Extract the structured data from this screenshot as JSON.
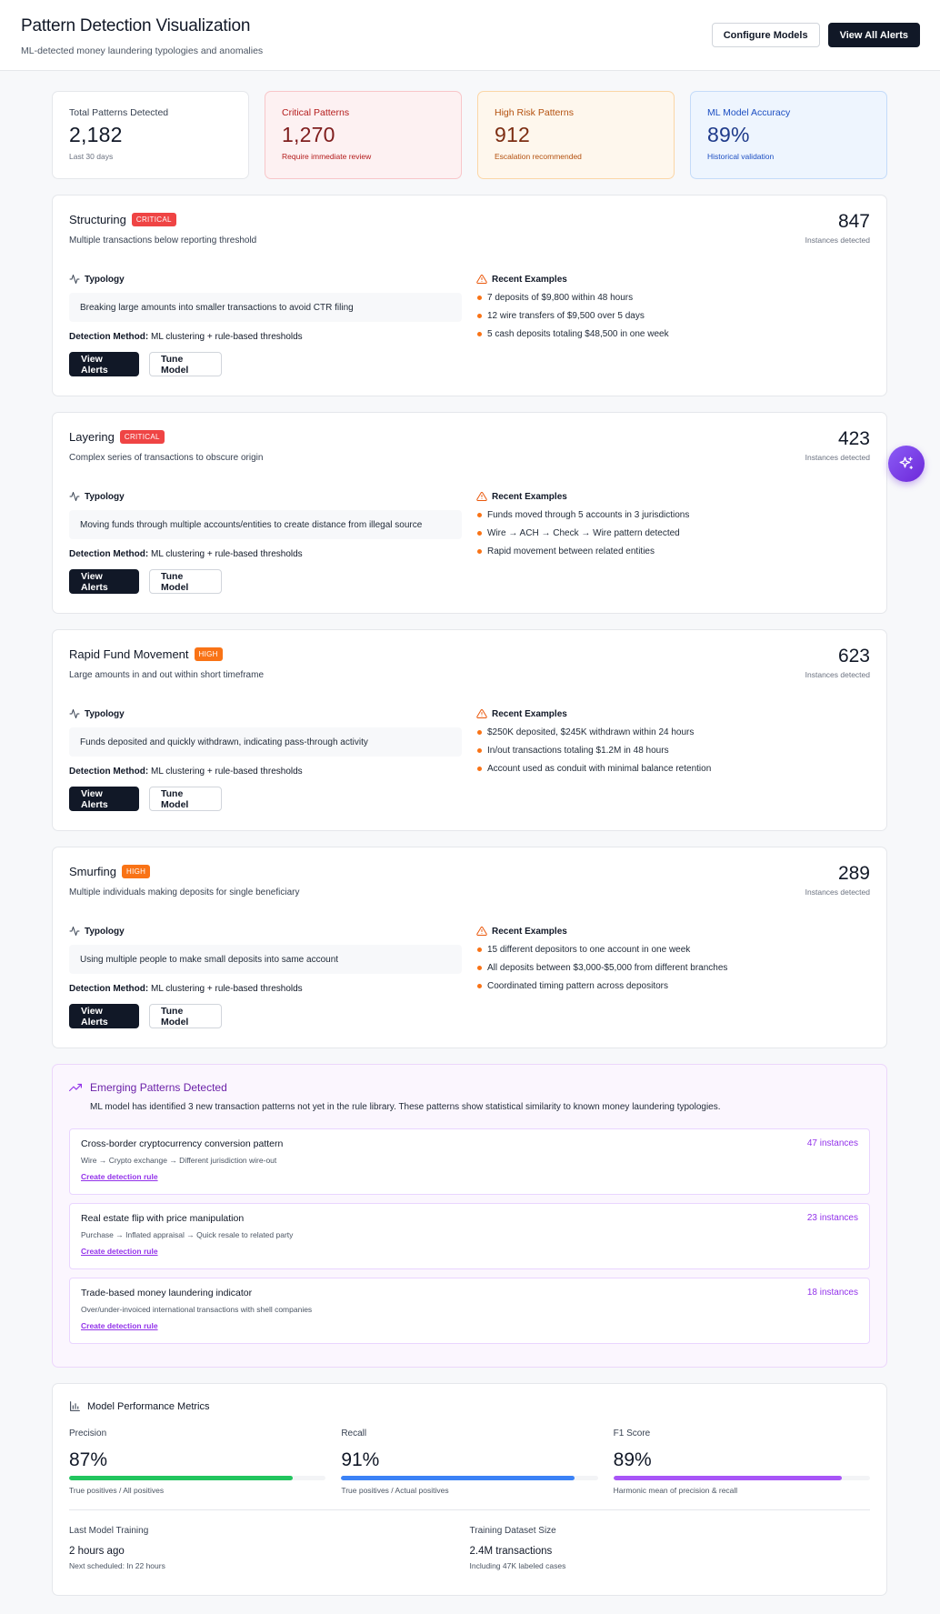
{
  "header": {
    "title": "Pattern Detection Visualization",
    "subtitle": "ML-detected money laundering typologies and anomalies",
    "configure_label": "Configure Models",
    "view_all_label": "View All Alerts"
  },
  "stats": [
    {
      "label": "Total Patterns Detected",
      "value": "2,182",
      "note": "Last 30 days",
      "tone": "neutral"
    },
    {
      "label": "Critical Patterns",
      "value": "1,270",
      "note": "Require immediate review",
      "tone": "critical"
    },
    {
      "label": "High Risk Patterns",
      "value": "912",
      "note": "Escalation recommended",
      "tone": "high"
    },
    {
      "label": "ML Model Accuracy",
      "value": "89%",
      "note": "Historical validation",
      "tone": "accuracy"
    }
  ],
  "pattern_common": {
    "typology_heading": "Typology",
    "examples_heading": "Recent Examples",
    "detection_label": "Detection Method:",
    "view_alerts_label": "View Alerts",
    "tune_model_label": "Tune Model",
    "instances_label": "Instances detected"
  },
  "patterns": [
    {
      "name": "Structuring",
      "severity": "CRITICAL",
      "description": "Multiple transactions below reporting threshold",
      "count": "847",
      "typology": "Breaking large amounts into smaller transactions to avoid CTR filing",
      "method": "ML clustering + rule-based thresholds",
      "examples": [
        "7 deposits of $9,800 within 48 hours",
        "12 wire transfers of $9,500 over 5 days",
        "5 cash deposits totaling $48,500 in one week"
      ]
    },
    {
      "name": "Layering",
      "severity": "CRITICAL",
      "description": "Complex series of transactions to obscure origin",
      "count": "423",
      "typology": "Moving funds through multiple accounts/entities to create distance from illegal source",
      "method": "ML clustering + rule-based thresholds",
      "examples": [
        "Funds moved through 5 accounts in 3 jurisdictions",
        "Wire → ACH → Check → Wire pattern detected",
        "Rapid movement between related entities"
      ]
    },
    {
      "name": "Rapid Fund Movement",
      "severity": "HIGH",
      "description": "Large amounts in and out within short timeframe",
      "count": "623",
      "typology": "Funds deposited and quickly withdrawn, indicating pass-through activity",
      "method": "ML clustering + rule-based thresholds",
      "examples": [
        "$250K deposited, $245K withdrawn within 24 hours",
        "In/out transactions totaling $1.2M in 48 hours",
        "Account used as conduit with minimal balance retention"
      ]
    },
    {
      "name": "Smurfing",
      "severity": "HIGH",
      "description": "Multiple individuals making deposits for single beneficiary",
      "count": "289",
      "typology": "Using multiple people to make small deposits into same account",
      "method": "ML clustering + rule-based thresholds",
      "examples": [
        "15 different depositors to one account in one week",
        "All deposits between $3,000-$5,000 from different branches",
        "Coordinated timing pattern across depositors"
      ]
    }
  ],
  "emerging": {
    "title": "Emerging Patterns Detected",
    "description": "ML model has identified 3 new transaction patterns not yet in the rule library. These patterns show statistical similarity to known money laundering typologies.",
    "link_label": "Create detection rule",
    "items": [
      {
        "title": "Cross-border cryptocurrency conversion pattern",
        "flow": "Wire → Crypto exchange → Different jurisdiction wire-out",
        "instances": "47 instances"
      },
      {
        "title": "Real estate flip with price manipulation",
        "flow": "Purchase → Inflated appraisal → Quick resale to related party",
        "instances": "23 instances"
      },
      {
        "title": "Trade-based money laundering indicator",
        "flow": "Over/under-invoiced international transactions with shell companies",
        "instances": "18 instances"
      }
    ]
  },
  "metrics": {
    "title": "Model Performance Metrics",
    "items": [
      {
        "label": "Precision",
        "value": "87%",
        "progress": 0.87,
        "color": "#22c55e",
        "note": "True positives / All positives"
      },
      {
        "label": "Recall",
        "value": "91%",
        "progress": 0.91,
        "color": "#3b82f6",
        "note": "True positives / Actual positives"
      },
      {
        "label": "F1 Score",
        "value": "89%",
        "progress": 0.89,
        "color": "#a855f7",
        "note": "Harmonic mean of precision & recall"
      }
    ],
    "training": [
      {
        "label": "Last Model Training",
        "value": "2 hours ago",
        "note": "Next scheduled: In 22 hours"
      },
      {
        "label": "Training Dataset Size",
        "value": "2.4M transactions",
        "note": "Including 47K labeled cases"
      }
    ]
  },
  "icons": {
    "typology": "activity-icon",
    "examples": "alert-triangle-icon",
    "emerging": "trending-up-icon",
    "metrics": "bar-chart-icon",
    "assistant": "sparkles-icon"
  }
}
